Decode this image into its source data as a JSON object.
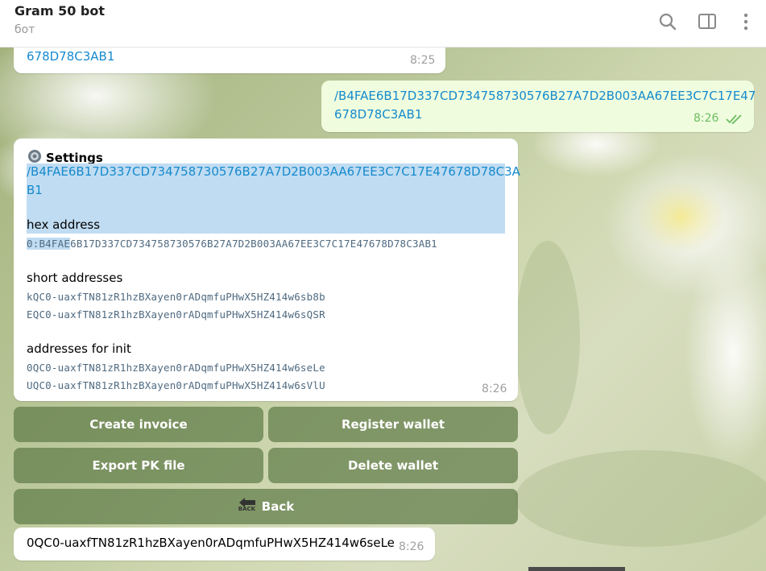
{
  "header": {
    "title": "Gram 50 bot",
    "subtitle": "бот",
    "icons": [
      "search-icon",
      "sidebar-toggle-icon",
      "more-vertical-icon"
    ]
  },
  "messages": {
    "first_tail": {
      "text": "678D78C3AB1",
      "time": "8:25"
    },
    "outgoing": {
      "line1": "/B4FAE6B17D337CD734758730576B27A7D2B003AA67EE3C7C17E47",
      "line2": "678D78C3AB1",
      "time": "8:26",
      "status": "read"
    },
    "settings": {
      "title": "Settings",
      "cmd_line1": "/B4FAE6B17D337CD734758730576B27A7D2B003AA67EE3C7C17E47678D78C3A",
      "cmd_line2": "B1",
      "hex_label": "hex address",
      "hex_sel": "0:B4FAE",
      "hex_rest": "6B17D337CD734758730576B27A7D2B003AA67EE3C7C17E47678D78C3AB1",
      "short_label": "short addresses",
      "short1": "kQC0-uaxfTN81zR1hzBXayen0rADqmfuPHwX5HZ414w6sb8b",
      "short2": "EQC0-uaxfTN81zR1hzBXayen0rADqmfuPHwX5HZ414w6sQSR",
      "init_label": "addresses for init",
      "init1": "0QC0-uaxfTN81zR1hzBXayen0rADqmfuPHwX5HZ414w6seLe",
      "init2": "UQC0-uaxfTN81zR1hzBXayen0rADqmfuPHwX5HZ414w6sVlU",
      "time": "8:26"
    },
    "last": {
      "text": "0QC0-uaxfTN81zR1hzBXayen0rADqmfuPHwX5HZ414w6seLe",
      "time": "8:26"
    }
  },
  "keyboard": {
    "create_invoice": "Create invoice",
    "register_wallet": "Register wallet",
    "export_pk": "Export PK file",
    "delete_wallet": "Delete wallet",
    "back": "Back",
    "back_icon_text": "BACK"
  },
  "colors": {
    "link": "#168acd",
    "outgoing_bubble": "#effdde",
    "selection": "#c0dcf2",
    "read_check": "#6cbd5f"
  }
}
